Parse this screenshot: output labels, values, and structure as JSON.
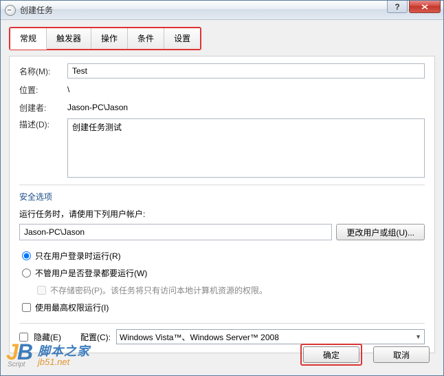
{
  "window": {
    "title": "创建任务"
  },
  "tabs": {
    "items": [
      {
        "label": "常规",
        "active": true
      },
      {
        "label": "触发器",
        "active": false
      },
      {
        "label": "操作",
        "active": false
      },
      {
        "label": "条件",
        "active": false
      },
      {
        "label": "设置",
        "active": false
      }
    ]
  },
  "form": {
    "name_label": "名称(M):",
    "name_value": "Test",
    "location_label": "位置:",
    "location_value": "\\",
    "creator_label": "创建者:",
    "creator_value": "Jason-PC\\Jason",
    "description_label": "描述(D):",
    "description_value": "创建任务测试"
  },
  "security": {
    "section_title": "安全选项",
    "run_as_label": "运行任务时，请使用下列用户帐户:",
    "account_value": "Jason-PC\\Jason",
    "change_user_btn": "更改用户或组(U)...",
    "radio_logged_on": "只在用户登录时运行(R)",
    "radio_any_login": "不管用户是否登录都要运行(W)",
    "no_store_pw": "不存储密码(P)。该任务将只有访问本地计算机资源的权限。",
    "highest_priv": "使用最高权限运行(I)"
  },
  "bottom": {
    "hidden_label": "隐藏(E)",
    "configure_label": "配置(C):",
    "configure_value": "Windows Vista™、Windows Server™ 2008"
  },
  "buttons": {
    "ok": "确定",
    "cancel": "取消"
  },
  "watermark": {
    "site_cn": "脚本之家",
    "site_url": "jb51.net",
    "script": "Script"
  }
}
